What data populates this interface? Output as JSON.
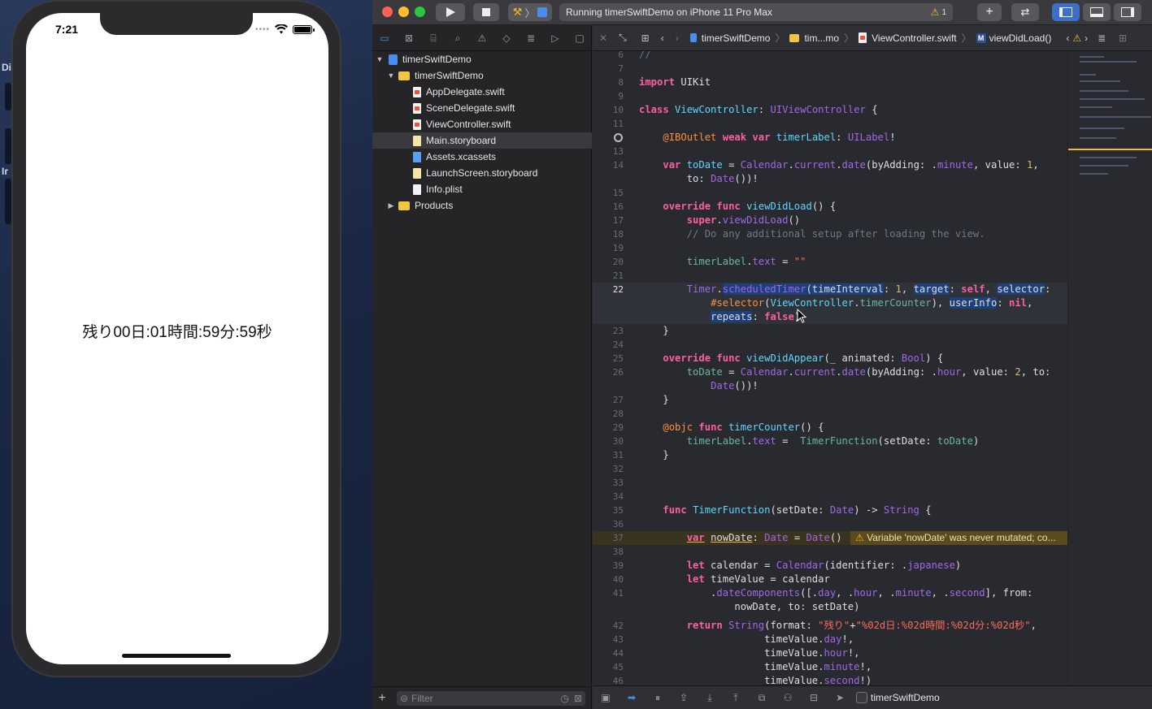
{
  "simulator": {
    "status_time": "7:21",
    "timer_text": "残り00日:01時間:59分:59秒"
  },
  "desktop": {
    "labels": [
      "Di",
      "Ir"
    ]
  },
  "toolbar": {
    "activity": "Running timerSwiftDemo on iPhone 11 Pro Max",
    "warning_count": "1"
  },
  "navigator": {
    "project": "timerSwiftDemo",
    "group": "timerSwiftDemo",
    "files": [
      "AppDelegate.swift",
      "SceneDelegate.swift",
      "ViewController.swift",
      "Main.storyboard",
      "Assets.xcassets",
      "LaunchScreen.storyboard",
      "Info.plist"
    ],
    "products": "Products",
    "filter_placeholder": "Filter"
  },
  "breadcrumb": {
    "project": "timerSwiftDemo",
    "folder": "tim...mo",
    "file": "ViewController.swift",
    "method": "viewDidLoad()"
  },
  "editor": {
    "warning_message": "Variable 'nowDate' was never mutated; co..."
  },
  "debugbar": {
    "target": "timerSwiftDemo"
  },
  "colors": {
    "accent": "#1d3f7a",
    "keyword": "#fc5fa3",
    "warning": "#f7b928"
  }
}
